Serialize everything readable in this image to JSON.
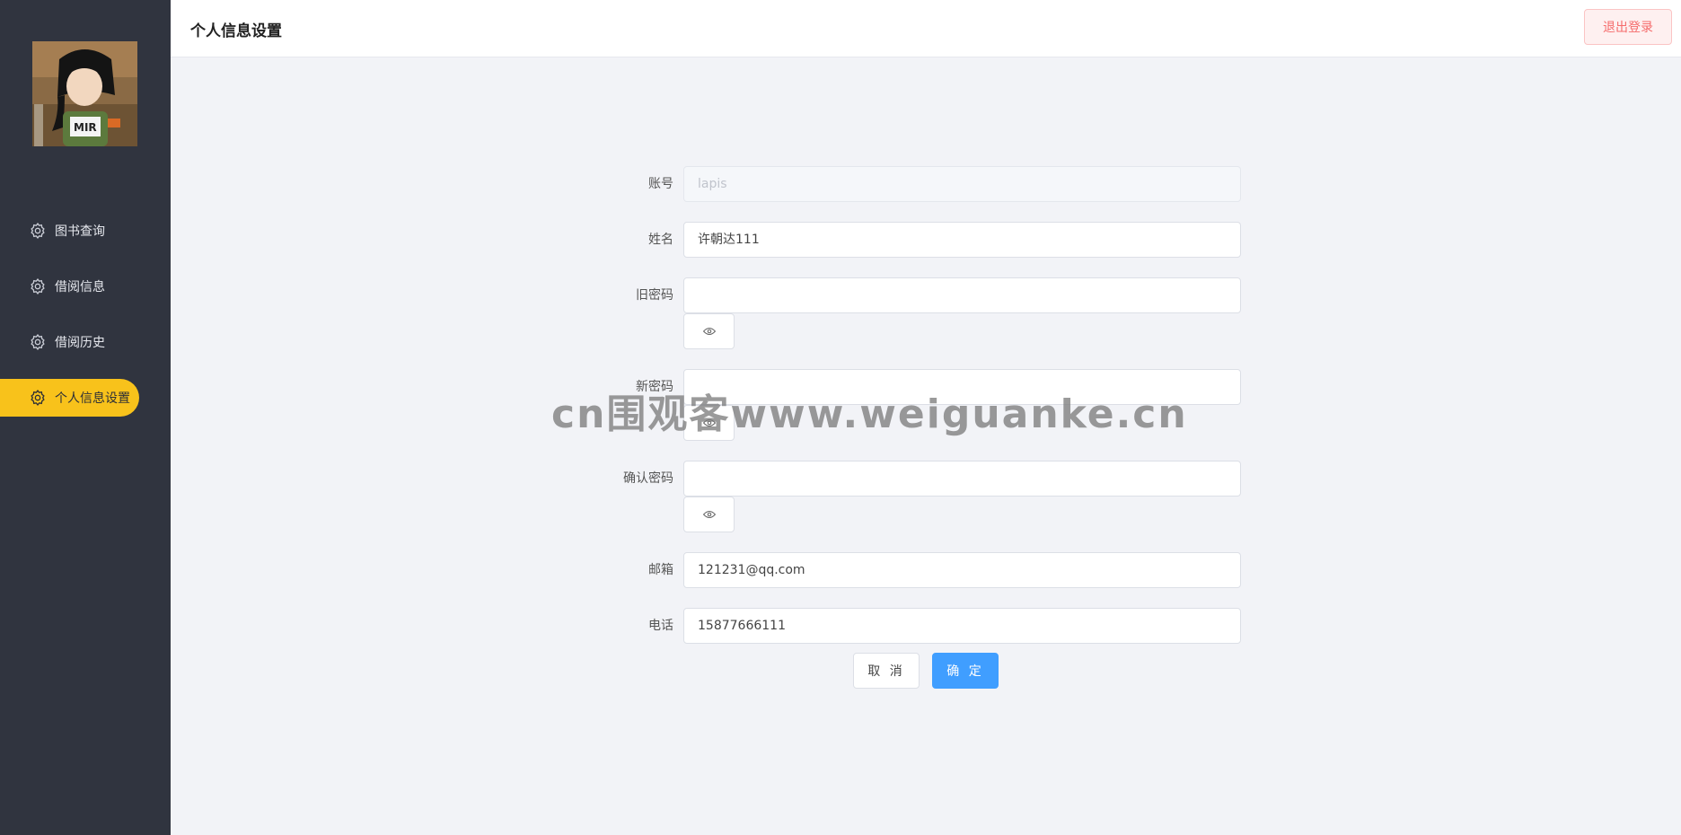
{
  "sidebar": {
    "items": [
      {
        "label": "图书查询",
        "icon": "gear-icon",
        "active": false
      },
      {
        "label": "借阅信息",
        "icon": "gear-icon",
        "active": false
      },
      {
        "label": "借阅历史",
        "icon": "gear-icon",
        "active": false
      },
      {
        "label": "个人信息设置",
        "icon": "gear-icon",
        "active": true
      }
    ],
    "active_color": "#f8c21b",
    "background": "#30343f"
  },
  "header": {
    "title": "个人信息设置",
    "logout_label": "退出登录"
  },
  "form": {
    "account": {
      "label": "账号",
      "value": "lapis"
    },
    "name": {
      "label": "姓名",
      "value": "许朝达111"
    },
    "old_password": {
      "label": "旧密码",
      "value": ""
    },
    "new_password": {
      "label": "新密码",
      "value": ""
    },
    "confirm_password": {
      "label": "确认密码",
      "value": ""
    },
    "email": {
      "label": "邮箱",
      "value": "121231@qq.com"
    },
    "phone": {
      "label": "电话",
      "value": "15877666111"
    },
    "cancel_label": "取 消",
    "confirm_label": "确 定",
    "primary_color": "#409eff"
  },
  "watermark": "cn围观客www.weiguanke.cn"
}
